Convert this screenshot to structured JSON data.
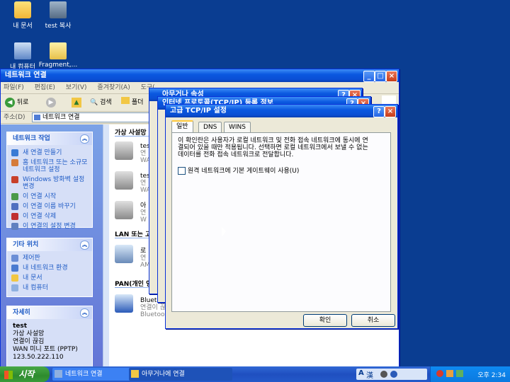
{
  "desktop": {
    "icons": [
      "내 문서",
      "test 복사",
      "내 컴퓨터",
      "Fragment,..."
    ]
  },
  "main_window": {
    "title": "네트워크 연결",
    "menu": [
      "파일(F)",
      "편집(E)",
      "보기(V)",
      "즐겨찾기(A)",
      "도구("
    ],
    "toolbar": {
      "back": "뒤로",
      "search": "검색",
      "folders": "폴더"
    },
    "address_label": "주소(D)",
    "address_value": "네트워크 연결",
    "task_pane": {
      "network_tasks": {
        "title": "네트워크 작업",
        "items": [
          "새 연결 만들기",
          "홈 네트워크 또는 소규모 네트워크 설정",
          "Windows 방화벽 설정 변경",
          "이 연결 시작",
          "이 연결 이름 바꾸기",
          "이 연결 삭제",
          "이 연결의 설정 변경"
        ]
      },
      "other_places": {
        "title": "기타 위치",
        "items": [
          "제어판",
          "내 네트워크 환경",
          "내 문서",
          "내 컴퓨터"
        ]
      },
      "details": {
        "title": "자세히",
        "lines": [
          "test",
          "가상 사설망",
          "연결이 끊김",
          "WAN 미니 포트 (PPTP)",
          "123.50.222.110"
        ]
      }
    },
    "groups": {
      "vpn": "가상 사설망",
      "lan": "LAN 또는 고",
      "pan": "PAN(개인 영"
    },
    "connections": [
      {
        "name": "tes",
        "sub1": "연",
        "sub2": "WA"
      },
      {
        "name": "tes",
        "sub1": "연",
        "sub2": "WA"
      },
      {
        "name": "아",
        "sub1": "연",
        "sub2": "W"
      },
      {
        "name": "로",
        "sub1": "연",
        "sub2": "AM"
      },
      {
        "name": "Blueto",
        "sub1": "연결이 끊",
        "sub2": "Bluetoo"
      }
    ]
  },
  "back_windows": {
    "w1_title": "아무거나 속성",
    "w2_title": "인터넷 프로토콜(TCP/IP) 등록 정보"
  },
  "dialog": {
    "title": "고급 TCP/IP 설정",
    "tabs": [
      "일반",
      "DNS",
      "WINS"
    ],
    "description": "이 확인란은 사용자가 로컬 네트워크 및 전화 접속 네트워크에 동시에 연결되어 있을 때만 적용됩니다. 선택하면 로컬 네트워크에서 보낼 수 없는 데이터를 전화 접속 네트워크로 전달합니다.",
    "checkbox_label": "원격 네트워크에 기본 게이트웨이 사용(U)",
    "checkbox_checked": false,
    "ok": "확인",
    "cancel": "취소"
  },
  "taskbar": {
    "start": "시작",
    "tasks": [
      "네트워크 연결",
      "아무거나에 연결"
    ],
    "ime": "A",
    "hanja": "漢",
    "clock": "오후 2:34"
  },
  "colors": {
    "desktop": "#0a3d91",
    "titlebar": "#0a58e0",
    "link": "#215dc6"
  }
}
